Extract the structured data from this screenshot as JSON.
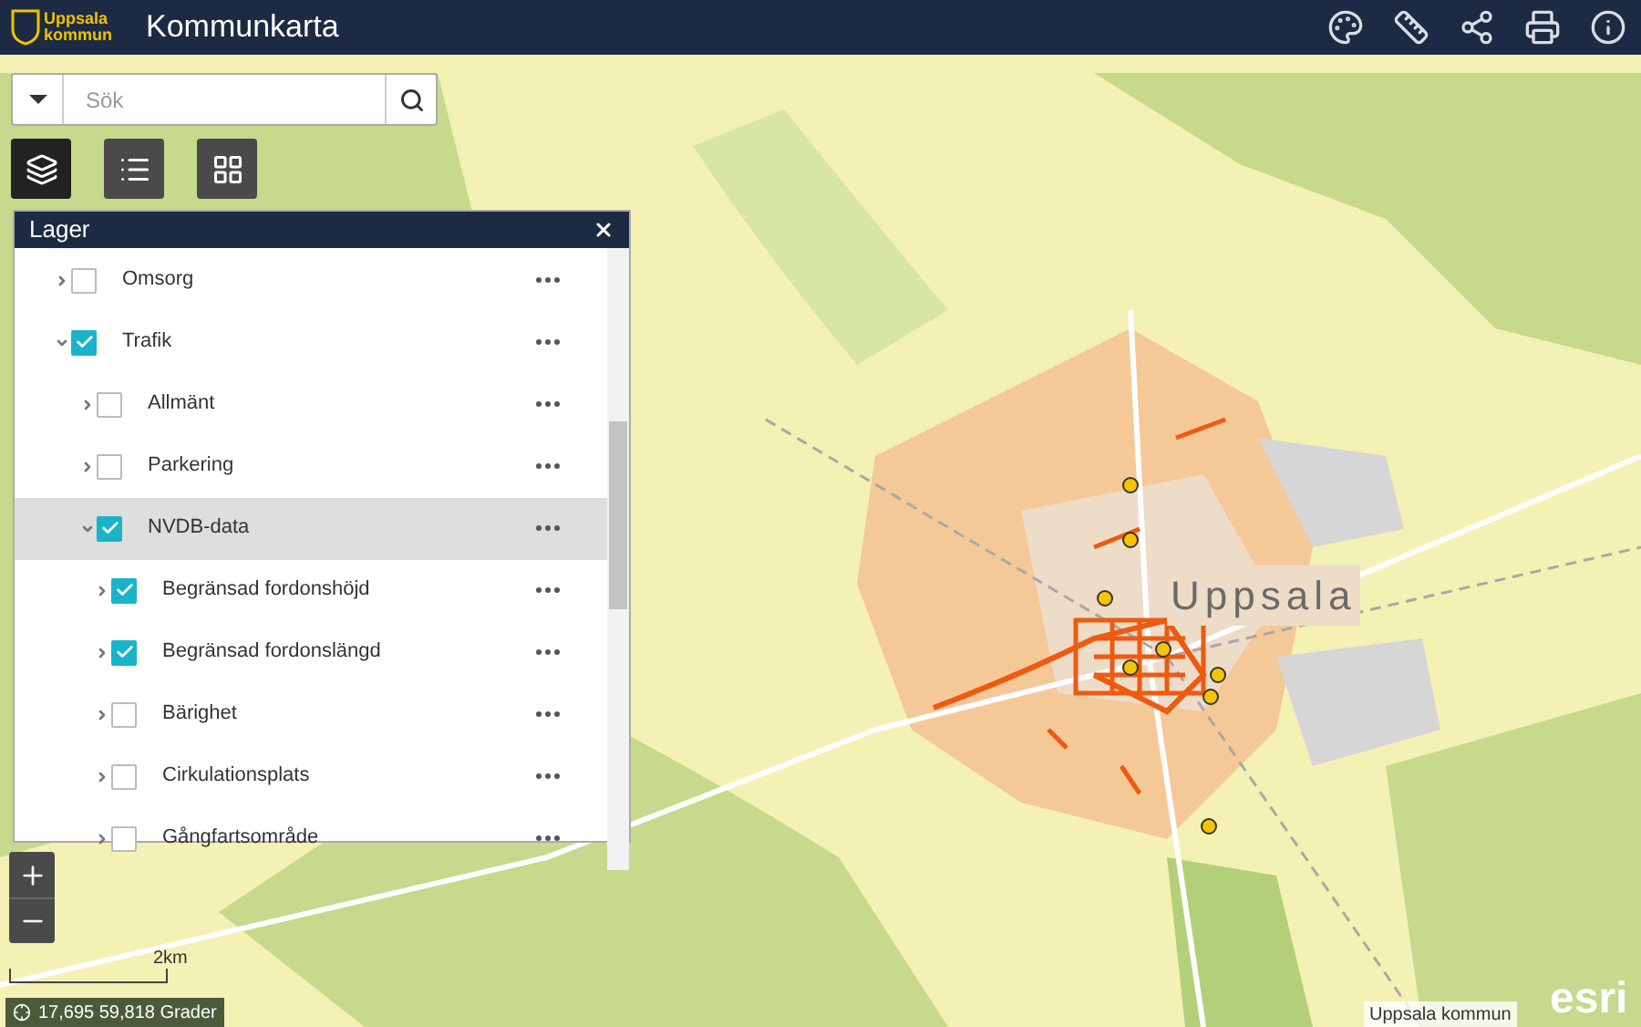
{
  "header": {
    "logo": "Uppsala kommun",
    "title": "Kommunkarta"
  },
  "search": {
    "placeholder": "Sök"
  },
  "widgets": [
    {
      "kind": "layers",
      "selected": true
    },
    {
      "kind": "legend",
      "selected": false
    },
    {
      "kind": "basemap",
      "selected": false
    }
  ],
  "layer_panel": {
    "title": "Lager",
    "items": [
      {
        "label": "Omsorg",
        "checked": false,
        "expanded": false,
        "selected": false
      },
      {
        "label": "Trafik",
        "checked": true,
        "expanded": true,
        "selected": false,
        "children": [
          {
            "label": "Allmänt",
            "checked": false,
            "expanded": false,
            "selected": false
          },
          {
            "label": "Parkering",
            "checked": false,
            "expanded": false,
            "selected": false
          },
          {
            "label": "NVDB-data",
            "checked": true,
            "expanded": true,
            "selected": true,
            "children": [
              {
                "label": "Begränsad fordonshöjd",
                "checked": true,
                "expanded": false,
                "selected": false
              },
              {
                "label": "Begränsad fordonslängd",
                "checked": true,
                "expanded": false,
                "selected": false
              },
              {
                "label": "Bärighet",
                "checked": false,
                "expanded": false,
                "selected": false
              },
              {
                "label": "Cirkulationsplats",
                "checked": false,
                "expanded": false,
                "selected": false
              },
              {
                "label": "Gångfartsområde",
                "checked": false,
                "expanded": false,
                "selected": false
              }
            ]
          }
        ]
      }
    ]
  },
  "map": {
    "place_label": "Uppsala",
    "scale": "2km",
    "coordinates": "17,695 59,818 Grader",
    "attribution": "Uppsala kommun",
    "provider_logo": "esri"
  }
}
